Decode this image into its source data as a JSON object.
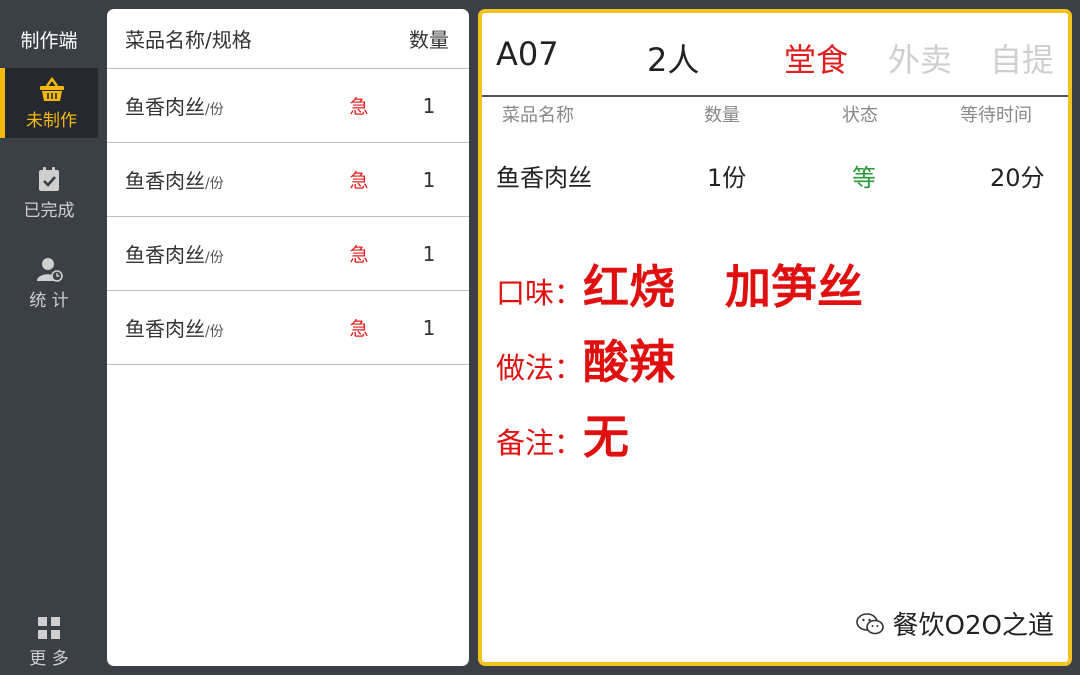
{
  "app": {
    "title": "制作端"
  },
  "nav": {
    "items": [
      {
        "label": "未制作",
        "icon": "basket-icon"
      },
      {
        "label": "已完成",
        "icon": "calendar-check-icon"
      },
      {
        "label": "统 计",
        "icon": "user-stats-icon"
      }
    ],
    "more": {
      "label": "更 多",
      "icon": "grid-icon"
    }
  },
  "list": {
    "headers": {
      "name": "菜品名称/规格",
      "qty": "数量"
    },
    "rows": [
      {
        "name": "鱼香肉丝",
        "unit": "/份",
        "urgent": "急",
        "qty": "1"
      },
      {
        "name": "鱼香肉丝",
        "unit": "/份",
        "urgent": "急",
        "qty": "1"
      },
      {
        "name": "鱼香肉丝",
        "unit": "/份",
        "urgent": "急",
        "qty": "1"
      },
      {
        "name": "鱼香肉丝",
        "unit": "/份",
        "urgent": "急",
        "qty": "1"
      }
    ]
  },
  "detail": {
    "table_no": "A07",
    "people": "2人",
    "modes": [
      "堂食",
      "外卖",
      "自提"
    ],
    "active_mode": "堂食",
    "columns": {
      "name": "菜品名称",
      "qty": "数量",
      "status": "状态",
      "wait": "等待时间"
    },
    "item": {
      "name": "鱼香肉丝",
      "qty": "1份",
      "status": "等",
      "wait": "20分"
    },
    "taste": {
      "label": "口味：",
      "values": [
        "红烧",
        "加笋丝"
      ]
    },
    "method": {
      "label": "做法：",
      "value": "酸辣"
    },
    "note": {
      "label": "备注：",
      "value": "无"
    }
  },
  "watermark": {
    "text": "餐饮O2O之道",
    "icon": "wechat-icon"
  },
  "colors": {
    "accent": "#f5b80c",
    "border": "#f2c322",
    "red": "#e02020",
    "green": "#2a9a3a",
    "sidebar": "#3b3f46"
  }
}
